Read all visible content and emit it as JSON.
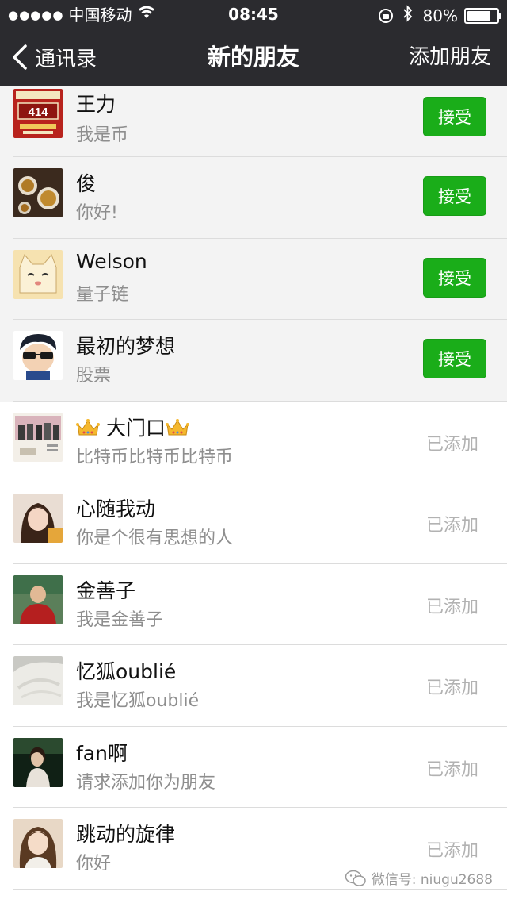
{
  "status_bar": {
    "signal_dots": "●●●●●",
    "carrier": "中国移动",
    "time": "08:45",
    "battery": "80%",
    "battery_level": 0.8
  },
  "nav": {
    "back_label": "通讯录",
    "title": "新的朋友",
    "action_label": "添加朋友"
  },
  "requests": [
    {
      "name": "王力",
      "message": "我是币",
      "status": "pending",
      "button": "接受",
      "avatar": "poster-414",
      "avatar_text": "414"
    },
    {
      "name": "俊",
      "message": "你好!",
      "status": "pending",
      "button": "接受",
      "avatar": "tea-cups"
    },
    {
      "name": "Welson",
      "message": "量子链",
      "status": "pending",
      "button": "接受",
      "avatar": "cartoon-cat"
    },
    {
      "name": "最初的梦想",
      "message": "股票",
      "status": "pending",
      "button": "接受",
      "avatar": "cartoon-boy-sunglasses"
    },
    {
      "name": "大门口",
      "message": "比特币比特币比特币",
      "status": "added",
      "label": "已添加",
      "avatar": "people-photo",
      "crowns": true
    },
    {
      "name": "心随我动",
      "message": "你是个很有思想的人",
      "status": "added",
      "label": "已添加",
      "avatar": "girl-portrait"
    },
    {
      "name": "金善子",
      "message": "我是金善子",
      "status": "added",
      "label": "已添加",
      "avatar": "man-red-coat"
    },
    {
      "name": "忆狐oublié",
      "message": "我是忆狐oublié",
      "status": "added",
      "label": "已添加",
      "avatar": "white-fur"
    },
    {
      "name": "fan啊",
      "message": "请求添加你为朋友",
      "status": "added",
      "label": "已添加",
      "avatar": "woman-dark-photo"
    },
    {
      "name": "跳动的旋律",
      "message": "你好",
      "status": "added",
      "label": "已添加",
      "avatar": "woman-portrait"
    }
  ],
  "watermark": "微信号: niugu2688",
  "colors": {
    "bar_bg": "#2b2b2f",
    "accept_green": "#1aad19",
    "pending_row_bg": "#f3f3f3",
    "secondary_text": "#8e8e8e",
    "added_text": "#b2b2b2"
  }
}
